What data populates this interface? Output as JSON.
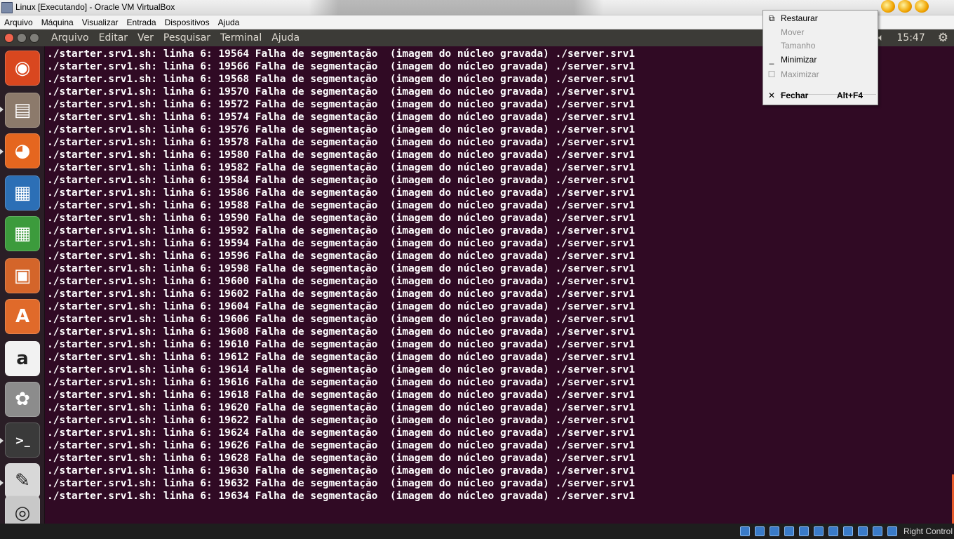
{
  "host_window": {
    "title": "Linux [Executando] - Oracle VM VirtualBox",
    "menu": [
      "Arquivo",
      "Máquina",
      "Visualizar",
      "Entrada",
      "Dispositivos",
      "Ajuda"
    ]
  },
  "guest_panel": {
    "terminal_menu": [
      "Arquivo",
      "Editar",
      "Ver",
      "Pesquisar",
      "Terminal",
      "Ajuda"
    ],
    "clock": "15:47",
    "volume_icon": "speaker-icon",
    "settings_icon": "gear-icon"
  },
  "launcher": {
    "items": [
      {
        "name": "ubuntu-dash-icon",
        "glyph": "◉",
        "color": "#d9471f"
      },
      {
        "name": "files-icon",
        "glyph": "▤",
        "color": "#8c7a6b"
      },
      {
        "name": "firefox-icon",
        "glyph": "◕",
        "color": "#e5661f"
      },
      {
        "name": "writer-icon",
        "glyph": "▦",
        "color": "#2c6fb6"
      },
      {
        "name": "calc-icon",
        "glyph": "▦",
        "color": "#3c9b3c"
      },
      {
        "name": "impress-icon",
        "glyph": "▣",
        "color": "#d4652a"
      },
      {
        "name": "software-center-icon",
        "glyph": "A",
        "color": "#e06a2a"
      },
      {
        "name": "amazon-icon",
        "glyph": "a",
        "color": "#f2f2f2"
      },
      {
        "name": "system-settings-icon",
        "glyph": "✿",
        "color": "#8c8c8c"
      },
      {
        "name": "terminal-icon",
        "glyph": ">_",
        "color": "#3a3a3a"
      },
      {
        "name": "text-editor-icon",
        "glyph": "✎",
        "color": "#d8d8d8"
      },
      {
        "name": "dvd-icon",
        "glyph": "◎",
        "color": "#c8c8c8"
      }
    ]
  },
  "terminal": {
    "lines": [
      "./starter.srv1.sh: linha 6: 19564 Falha de segmentação  (imagem do núcleo gravada) ./server.srv1",
      "./starter.srv1.sh: linha 6: 19566 Falha de segmentação  (imagem do núcleo gravada) ./server.srv1",
      "./starter.srv1.sh: linha 6: 19568 Falha de segmentação  (imagem do núcleo gravada) ./server.srv1",
      "./starter.srv1.sh: linha 6: 19570 Falha de segmentação  (imagem do núcleo gravada) ./server.srv1",
      "./starter.srv1.sh: linha 6: 19572 Falha de segmentação  (imagem do núcleo gravada) ./server.srv1",
      "./starter.srv1.sh: linha 6: 19574 Falha de segmentação  (imagem do núcleo gravada) ./server.srv1",
      "./starter.srv1.sh: linha 6: 19576 Falha de segmentação  (imagem do núcleo gravada) ./server.srv1",
      "./starter.srv1.sh: linha 6: 19578 Falha de segmentação  (imagem do núcleo gravada) ./server.srv1",
      "./starter.srv1.sh: linha 6: 19580 Falha de segmentação  (imagem do núcleo gravada) ./server.srv1",
      "./starter.srv1.sh: linha 6: 19582 Falha de segmentação  (imagem do núcleo gravada) ./server.srv1",
      "./starter.srv1.sh: linha 6: 19584 Falha de segmentação  (imagem do núcleo gravada) ./server.srv1",
      "./starter.srv1.sh: linha 6: 19586 Falha de segmentação  (imagem do núcleo gravada) ./server.srv1",
      "./starter.srv1.sh: linha 6: 19588 Falha de segmentação  (imagem do núcleo gravada) ./server.srv1",
      "./starter.srv1.sh: linha 6: 19590 Falha de segmentação  (imagem do núcleo gravada) ./server.srv1",
      "./starter.srv1.sh: linha 6: 19592 Falha de segmentação  (imagem do núcleo gravada) ./server.srv1",
      "./starter.srv1.sh: linha 6: 19594 Falha de segmentação  (imagem do núcleo gravada) ./server.srv1",
      "./starter.srv1.sh: linha 6: 19596 Falha de segmentação  (imagem do núcleo gravada) ./server.srv1",
      "./starter.srv1.sh: linha 6: 19598 Falha de segmentação  (imagem do núcleo gravada) ./server.srv1",
      "./starter.srv1.sh: linha 6: 19600 Falha de segmentação  (imagem do núcleo gravada) ./server.srv1",
      "./starter.srv1.sh: linha 6: 19602 Falha de segmentação  (imagem do núcleo gravada) ./server.srv1",
      "./starter.srv1.sh: linha 6: 19604 Falha de segmentação  (imagem do núcleo gravada) ./server.srv1",
      "./starter.srv1.sh: linha 6: 19606 Falha de segmentação  (imagem do núcleo gravada) ./server.srv1",
      "./starter.srv1.sh: linha 6: 19608 Falha de segmentação  (imagem do núcleo gravada) ./server.srv1",
      "./starter.srv1.sh: linha 6: 19610 Falha de segmentação  (imagem do núcleo gravada) ./server.srv1",
      "./starter.srv1.sh: linha 6: 19612 Falha de segmentação  (imagem do núcleo gravada) ./server.srv1",
      "./starter.srv1.sh: linha 6: 19614 Falha de segmentação  (imagem do núcleo gravada) ./server.srv1",
      "./starter.srv1.sh: linha 6: 19616 Falha de segmentação  (imagem do núcleo gravada) ./server.srv1",
      "./starter.srv1.sh: linha 6: 19618 Falha de segmentação  (imagem do núcleo gravada) ./server.srv1",
      "./starter.srv1.sh: linha 6: 19620 Falha de segmentação  (imagem do núcleo gravada) ./server.srv1",
      "./starter.srv1.sh: linha 6: 19622 Falha de segmentação  (imagem do núcleo gravada) ./server.srv1",
      "./starter.srv1.sh: linha 6: 19624 Falha de segmentação  (imagem do núcleo gravada) ./server.srv1",
      "./starter.srv1.sh: linha 6: 19626 Falha de segmentação  (imagem do núcleo gravada) ./server.srv1",
      "./starter.srv1.sh: linha 6: 19628 Falha de segmentação  (imagem do núcleo gravada) ./server.srv1",
      "./starter.srv1.sh: linha 6: 19630 Falha de segmentação  (imagem do núcleo gravada) ./server.srv1",
      "./starter.srv1.sh: linha 6: 19632 Falha de segmentação  (imagem do núcleo gravada) ./server.srv1",
      "./starter.srv1.sh: linha 6: 19634 Falha de segmentação  (imagem do núcleo gravada) ./server.srv1"
    ]
  },
  "status_bar": {
    "icons": [
      "hard-disk-icon",
      "optical-drive-icon",
      "audio-icon",
      "network-icon",
      "usb-icon",
      "shared-folders-icon",
      "display-icon",
      "video-capture-icon",
      "virtualization-icon",
      "mouse-integration-icon",
      "keyboard-icon"
    ],
    "host_key": "Right Control"
  },
  "system_menu": {
    "items": [
      {
        "label": "Restaurar",
        "enabled": true,
        "icon": "restore-icon",
        "glyph": "⧉"
      },
      {
        "label": "Mover",
        "enabled": false,
        "icon": "",
        "glyph": ""
      },
      {
        "label": "Tamanho",
        "enabled": false,
        "icon": "",
        "glyph": ""
      },
      {
        "label": "Minimizar",
        "enabled": true,
        "icon": "minimize-icon",
        "glyph": "_"
      },
      {
        "label": "Maximizar",
        "enabled": false,
        "icon": "maximize-icon",
        "glyph": "☐"
      },
      {
        "label": "Fechar",
        "enabled": true,
        "icon": "close-icon",
        "glyph": "✕",
        "shortcut": "Alt+F4",
        "bold": true
      }
    ]
  }
}
